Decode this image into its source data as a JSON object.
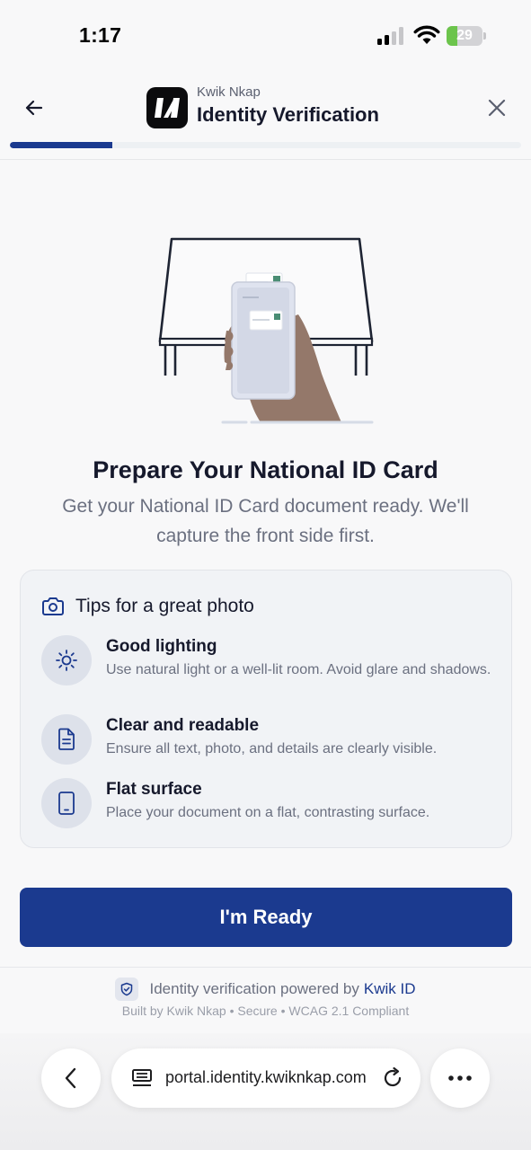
{
  "status_bar": {
    "time": "1:17",
    "battery_level": "29",
    "battery_fraction": 0.29,
    "icons": [
      "signal-icon",
      "wifi-icon",
      "battery-icon"
    ]
  },
  "header": {
    "brand_sub": "Kwik Nkap",
    "title": "Identity Verification",
    "progress_fraction": 0.2,
    "icons": [
      "back-arrow-icon",
      "brand-logo",
      "close-icon"
    ],
    "accent_color": "#1b3a8f"
  },
  "main": {
    "headline": "Prepare Your National ID Card",
    "subtext": "Get your National ID Card document ready. We'll capture the front side first."
  },
  "tips": {
    "title": "Tips for a great photo",
    "title_icon": "camera-icon",
    "items": [
      {
        "icon": "sun-icon",
        "title": "Good lighting",
        "desc": "Use natural light or a well-lit room. Avoid glare and shadows."
      },
      {
        "icon": "document-icon",
        "title": "Clear and readable",
        "desc": "Ensure all text, photo, and details are clearly visible."
      },
      {
        "icon": "tablet-icon",
        "title": "Flat surface",
        "desc": "Place your document on a flat, contrasting surface."
      }
    ]
  },
  "cta": {
    "label": "I'm Ready"
  },
  "footer": {
    "powered_text": "Identity verification powered by",
    "powered_link": "Kwik ID",
    "meta": "Built by Kwik Nkap • Secure • WCAG 2.1 Compliant"
  },
  "browser": {
    "url": "portal.identity.kwiknkap.com",
    "icons": [
      "browser-back-icon",
      "reader-icon",
      "reload-icon",
      "more-icon"
    ]
  }
}
